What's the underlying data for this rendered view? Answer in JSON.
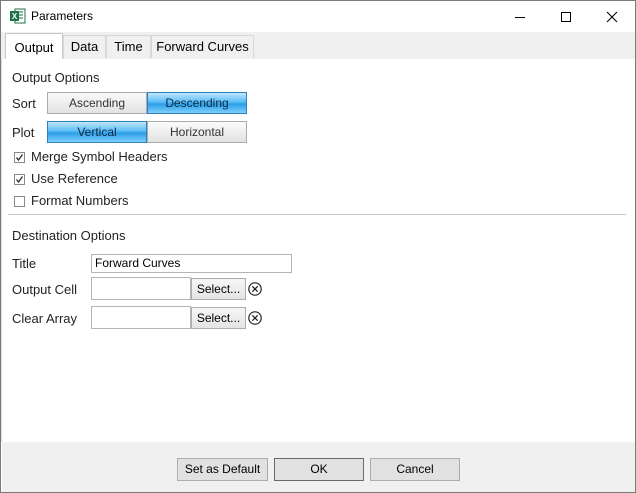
{
  "window": {
    "title": "Parameters",
    "icon": "excel-icon"
  },
  "tabs": [
    {
      "label": "Output",
      "active": true
    },
    {
      "label": "Data",
      "active": false
    },
    {
      "label": "Time",
      "active": false
    },
    {
      "label": "Forward Curves",
      "active": false
    }
  ],
  "output_options": {
    "heading": "Output Options",
    "sort": {
      "label": "Sort",
      "options": [
        "Ascending",
        "Descending"
      ],
      "selected": "Descending"
    },
    "plot": {
      "label": "Plot",
      "options": [
        "Vertical",
        "Horizontal"
      ],
      "selected": "Vertical"
    },
    "checkboxes": [
      {
        "label": "Merge Symbol Headers",
        "checked": true
      },
      {
        "label": "Use Reference",
        "checked": true
      },
      {
        "label": "Format Numbers",
        "checked": false
      }
    ]
  },
  "destination_options": {
    "heading": "Destination Options",
    "title": {
      "label": "Title",
      "value": "Forward Curves"
    },
    "output_cell": {
      "label": "Output Cell",
      "value": "",
      "button": "Select..."
    },
    "clear_array": {
      "label": "Clear Array",
      "value": "",
      "button": "Select..."
    }
  },
  "footer": {
    "set_default": "Set as Default",
    "ok": "OK",
    "cancel": "Cancel"
  },
  "colors": {
    "selected_segment": "#2b9ee6",
    "excel_green": "#1f7244"
  }
}
